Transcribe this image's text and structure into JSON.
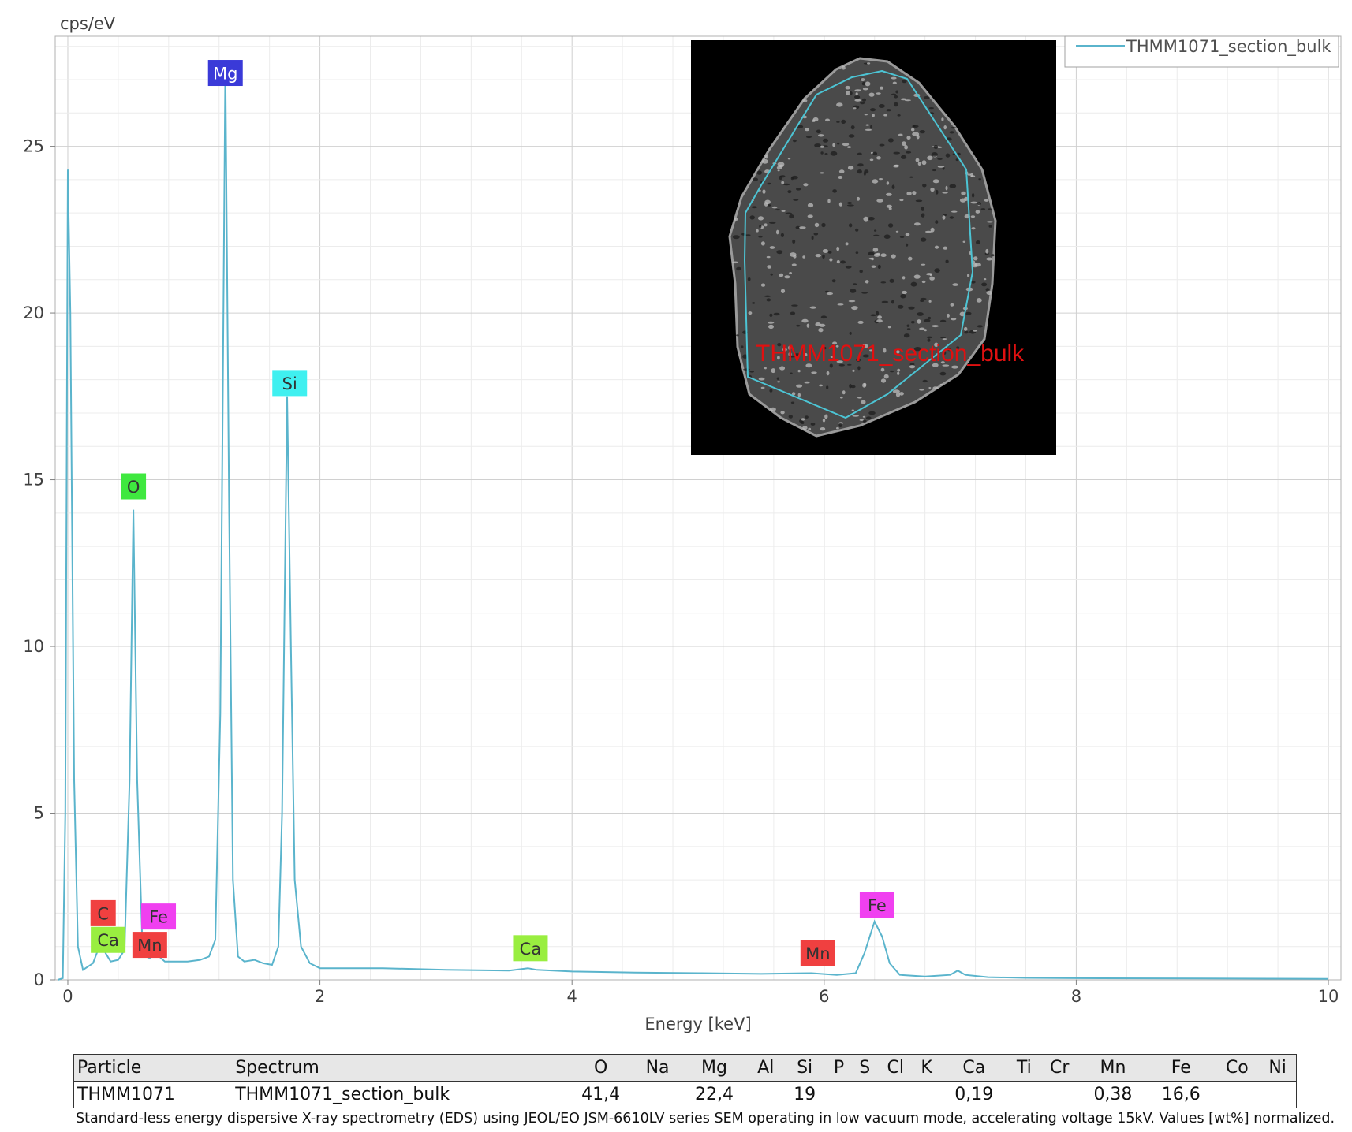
{
  "chart_data": {
    "type": "line",
    "ylabel": "cps/eV",
    "xlabel": "Energy [keV]",
    "xlim": [
      -0.1,
      10.1
    ],
    "ylim": [
      0,
      28.3
    ],
    "x_ticks": [
      0,
      2,
      4,
      6,
      8,
      10
    ],
    "y_ticks": [
      0,
      5,
      10,
      15,
      20,
      25
    ],
    "grid": true,
    "legend_position": "top-right",
    "series": [
      {
        "name": "THMM1071_section_bulk",
        "color": "#5ab4cc",
        "points": [
          [
            -0.08,
            0
          ],
          [
            -0.04,
            0.05
          ],
          [
            -0.02,
            5
          ],
          [
            0.0,
            24.3
          ],
          [
            0.02,
            20
          ],
          [
            0.05,
            6
          ],
          [
            0.08,
            1
          ],
          [
            0.12,
            0.3
          ],
          [
            0.2,
            0.5
          ],
          [
            0.24,
            0.9
          ],
          [
            0.27,
            1.1
          ],
          [
            0.3,
            0.8
          ],
          [
            0.34,
            0.55
          ],
          [
            0.4,
            0.6
          ],
          [
            0.45,
            0.9
          ],
          [
            0.49,
            6
          ],
          [
            0.52,
            14.1
          ],
          [
            0.55,
            6
          ],
          [
            0.59,
            1.2
          ],
          [
            0.62,
            0.7
          ],
          [
            0.65,
            0.65
          ],
          [
            0.68,
            0.85
          ],
          [
            0.71,
            0.75
          ],
          [
            0.74,
            0.65
          ],
          [
            0.77,
            0.55
          ],
          [
            0.85,
            0.55
          ],
          [
            0.95,
            0.55
          ],
          [
            1.05,
            0.6
          ],
          [
            1.12,
            0.7
          ],
          [
            1.17,
            1.2
          ],
          [
            1.21,
            8
          ],
          [
            1.25,
            27.5
          ],
          [
            1.28,
            14
          ],
          [
            1.31,
            3
          ],
          [
            1.35,
            0.7
          ],
          [
            1.4,
            0.55
          ],
          [
            1.48,
            0.6
          ],
          [
            1.55,
            0.5
          ],
          [
            1.62,
            0.45
          ],
          [
            1.67,
            1.0
          ],
          [
            1.7,
            5
          ],
          [
            1.74,
            17.5
          ],
          [
            1.77,
            10
          ],
          [
            1.8,
            3
          ],
          [
            1.85,
            1.0
          ],
          [
            1.92,
            0.5
          ],
          [
            2.0,
            0.35
          ],
          [
            2.5,
            0.35
          ],
          [
            3.0,
            0.3
          ],
          [
            3.5,
            0.28
          ],
          [
            3.65,
            0.35
          ],
          [
            3.72,
            0.3
          ],
          [
            4.0,
            0.25
          ],
          [
            4.5,
            0.22
          ],
          [
            5.0,
            0.2
          ],
          [
            5.5,
            0.18
          ],
          [
            5.9,
            0.2
          ],
          [
            6.1,
            0.15
          ],
          [
            6.25,
            0.2
          ],
          [
            6.32,
            0.8
          ],
          [
            6.4,
            1.75
          ],
          [
            6.46,
            1.3
          ],
          [
            6.52,
            0.5
          ],
          [
            6.6,
            0.15
          ],
          [
            6.8,
            0.1
          ],
          [
            7.0,
            0.15
          ],
          [
            7.06,
            0.28
          ],
          [
            7.12,
            0.15
          ],
          [
            7.3,
            0.08
          ],
          [
            7.6,
            0.06
          ],
          [
            8.0,
            0.05
          ],
          [
            9.0,
            0.04
          ],
          [
            10.0,
            0.03
          ]
        ]
      }
    ],
    "peak_labels": [
      {
        "text": "Mg",
        "x": 1.25,
        "y": 27.2,
        "color": "#3a3ad8",
        "text_color": "#ffffff"
      },
      {
        "text": "Si",
        "x": 1.76,
        "y": 17.9,
        "color": "#3ff0f0",
        "text_color": "#333333"
      },
      {
        "text": "O",
        "x": 0.52,
        "y": 14.8,
        "color": "#3fe83f",
        "text_color": "#333333"
      },
      {
        "text": "C",
        "x": 0.28,
        "y": 2.0,
        "color": "#f04040",
        "text_color": "#333333"
      },
      {
        "text": "Ca",
        "x": 0.32,
        "y": 1.2,
        "color": "#99ee40",
        "text_color": "#333333"
      },
      {
        "text": "Fe",
        "x": 0.72,
        "y": 1.9,
        "color": "#f040f0",
        "text_color": "#333333"
      },
      {
        "text": "Mn",
        "x": 0.65,
        "y": 1.05,
        "color": "#f04040",
        "text_color": "#333333"
      },
      {
        "text": "Ca",
        "x": 3.67,
        "y": 0.95,
        "color": "#99ee40",
        "text_color": "#333333"
      },
      {
        "text": "Mn",
        "x": 5.95,
        "y": 0.8,
        "color": "#f04040",
        "text_color": "#333333"
      },
      {
        "text": "Fe",
        "x": 6.42,
        "y": 2.25,
        "color": "#f040f0",
        "text_color": "#333333"
      }
    ]
  },
  "inset": {
    "region_label": "THMM1071_section_bulk",
    "label_color": "#e01010",
    "outline_color": "#4cc4d4"
  },
  "table": {
    "headers": [
      "Particle",
      "Spectrum",
      "O",
      "Na",
      "Mg",
      "Al",
      "Si",
      "P",
      "S",
      "Cl",
      "K",
      "Ca",
      "Ti",
      "Cr",
      "Mn",
      "Fe",
      "Co",
      "Ni"
    ],
    "rows": [
      [
        "THMM1071",
        "THMM1071_section_bulk",
        "41,4",
        "",
        "22,4",
        "",
        "19",
        "",
        "",
        "",
        "",
        "0,19",
        "",
        "",
        "0,38",
        "16,6",
        "",
        ""
      ]
    ]
  },
  "caption": "Standard-less energy dispersive X-ray spectrometry (EDS) using JEOL/EO JSM-6610LV series SEM operating in low vacuum mode, accelerating voltage 15kV. Values [wt%] normalized."
}
